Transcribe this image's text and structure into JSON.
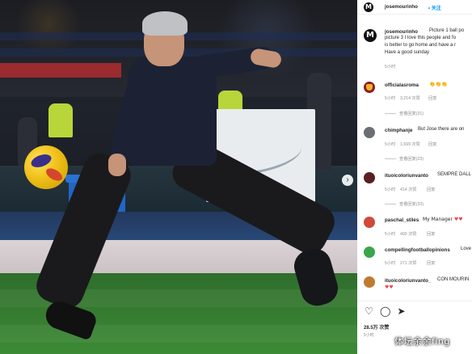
{
  "post": {
    "author": "josemourinho",
    "follow_label": "关注",
    "caption_lines": [
      "Picture 1 ball po",
      "picture 3 I love this people and fo",
      "is better to go home and have a r",
      "Have a good sunday"
    ],
    "caption_time": "5小时"
  },
  "comments": [
    {
      "user": "officialasroma",
      "text": "👏👏👏",
      "time": "5小时",
      "likes": "3,214 次赞",
      "reply": "回复",
      "view_replies": "查看回复(31)"
    },
    {
      "user": "chimphanje",
      "text": "But Jose there are on",
      "time": "5小时",
      "likes": "1,699 次赞",
      "reply": "回复",
      "view_replies": "查看回复(23)"
    },
    {
      "user": "ituoicoloriunvanto",
      "text": "SEMPRE DALL",
      "time": "5小时",
      "likes": "414 次赞",
      "reply": "回复",
      "view_replies": "查看回复(33)"
    },
    {
      "user": "paschal_stiles",
      "text": "My Manager ♥♥",
      "time": "5小时",
      "likes": "400 次赞",
      "reply": "回复"
    },
    {
      "user": "compellingfootballopinions",
      "text": "Love",
      "time": "5小时",
      "likes": "271 次赞",
      "reply": "回复"
    },
    {
      "user": "ituoicoloriunvanto_",
      "text": "CON MOURIN",
      "text2": "♥♥",
      "time": "5小时"
    }
  ],
  "footer": {
    "likes": "28.5万 次赞",
    "time": "5小时"
  },
  "watermark": "体坛余余fing",
  "colors": {
    "link": "#0095f6",
    "heart": "#ed4956"
  },
  "icons": [
    "heart-icon",
    "comment-icon",
    "share-icon",
    "next-arrow-icon"
  ]
}
